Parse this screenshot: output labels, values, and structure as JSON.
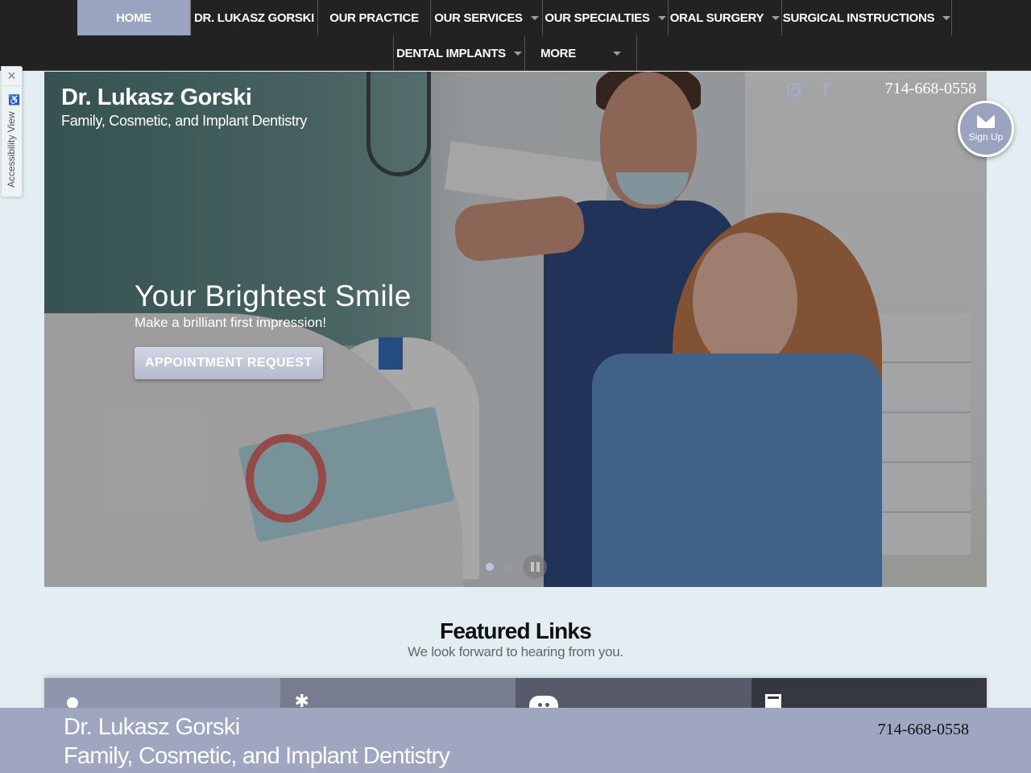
{
  "nav": {
    "row1": [
      {
        "label": "HOME",
        "active": true,
        "dropdown": false
      },
      {
        "label": "DR. LUKASZ GORSKI",
        "dropdown": false
      },
      {
        "label": "OUR PRACTICE",
        "dropdown": false
      },
      {
        "label": "OUR SERVICES",
        "dropdown": true
      },
      {
        "label": "OUR SPECIALTIES",
        "dropdown": true
      },
      {
        "label": "ORAL SURGERY",
        "dropdown": true
      },
      {
        "label": "SURGICAL INSTRUCTIONS",
        "dropdown": true
      }
    ],
    "row2": [
      {
        "label": "DENTAL IMPLANTS",
        "dropdown": true
      },
      {
        "label": "MORE",
        "dropdown": true
      }
    ]
  },
  "accessibility": {
    "close_icon": "×",
    "label": "Accessibility View",
    "icon": "♿"
  },
  "hero": {
    "brand_name": "Dr. Lukasz Gorski",
    "brand_tagline": "Family, Cosmetic, and Implant Dentistry",
    "social": [
      "instagram-icon",
      "facebook-icon"
    ],
    "facebook_glyph": "f",
    "phone": "714-668-0558",
    "headline": "Your Brightest Smile",
    "subheadline": "Make a brilliant first impression!",
    "cta_label": "APPOINTMENT REQUEST",
    "slides_count": 2,
    "active_slide": 1
  },
  "signup": {
    "label": "Sign Up"
  },
  "featured": {
    "title": "Featured Links",
    "subtitle": "We look forward to hearing from you.",
    "tiles": [
      {
        "icon": "person-icon"
      },
      {
        "icon": "gear-icon",
        "glyph": "✱"
      },
      {
        "icon": "tooth-icon"
      },
      {
        "icon": "document-icon"
      }
    ]
  },
  "sticky_footer": {
    "name": "Dr. Lukasz Gorski",
    "tagline": "Family, Cosmetic, and Implant Dentistry",
    "phone": "714-668-0558"
  },
  "colors": {
    "nav_bg": "#222222",
    "accent": "#9aa3bf",
    "page_bg": "#e3eef2"
  }
}
